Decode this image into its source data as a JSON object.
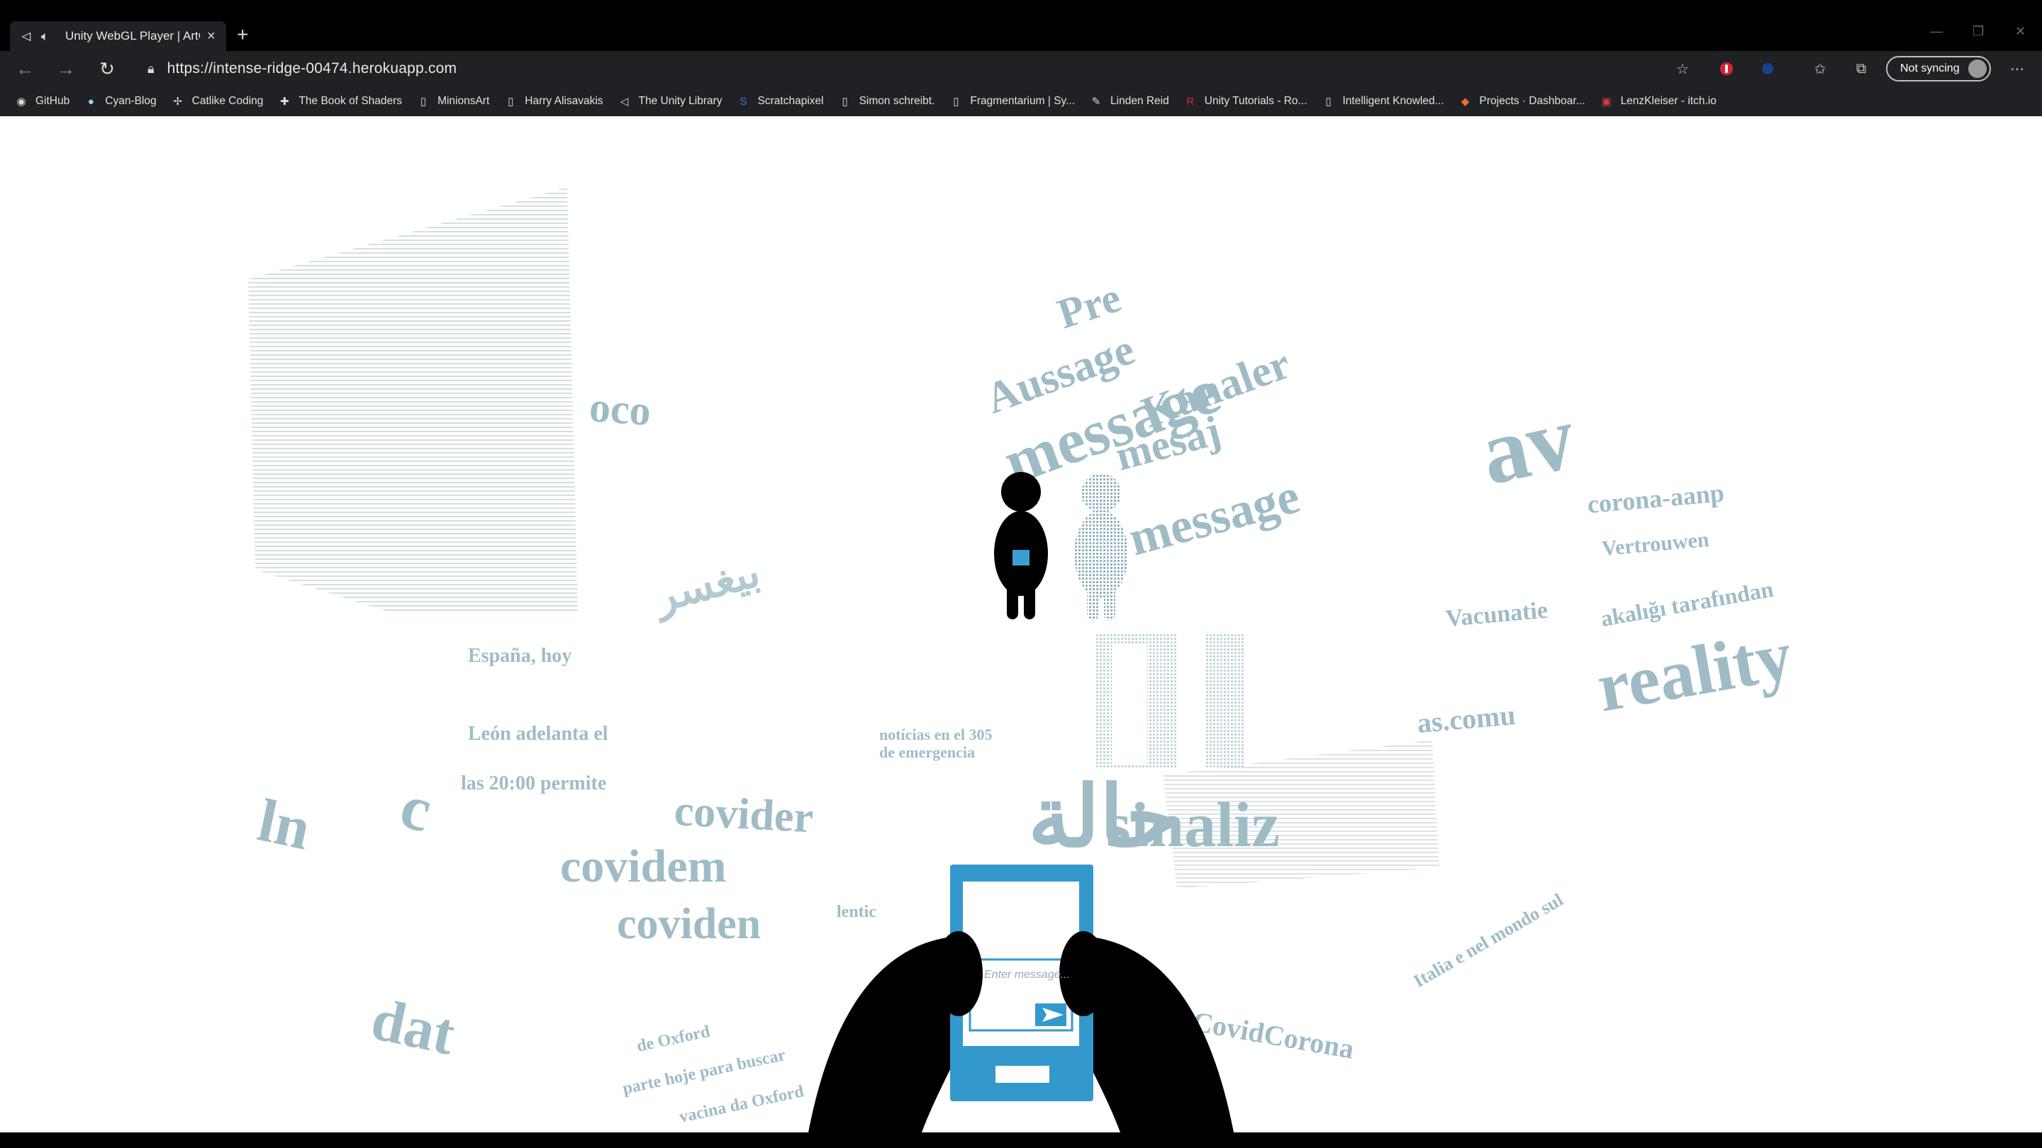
{
  "browser": {
    "tab_title": "Unity WebGL Player | ArtGa",
    "url": "https://intense-ridge-00474.herokuapp.com",
    "sync_label": "Not syncing",
    "bookmarks": [
      {
        "label": "GitHub",
        "icon": "github-icon"
      },
      {
        "label": "Cyan-Blog",
        "icon": "blog-icon"
      },
      {
        "label": "Catlike Coding",
        "icon": "catlike-icon"
      },
      {
        "label": "The Book of Shaders",
        "icon": "shader-icon"
      },
      {
        "label": "MinionsArt",
        "icon": "page-icon"
      },
      {
        "label": "Harry Alisavakis",
        "icon": "page-icon"
      },
      {
        "label": "The Unity Library",
        "icon": "unity-icon"
      },
      {
        "label": "Scratchapixel",
        "icon": "scratchapixel-icon"
      },
      {
        "label": "Simon schreibt.",
        "icon": "page-icon"
      },
      {
        "label": "Fragmentarium | Sy...",
        "icon": "page-icon"
      },
      {
        "label": "Linden Reid",
        "icon": "linden-icon"
      },
      {
        "label": "Unity Tutorials - Ro...",
        "icon": "r-icon"
      },
      {
        "label": "Intelligent Knowled...",
        "icon": "page-icon"
      },
      {
        "label": "Projects · Dashboar...",
        "icon": "gitlab-icon"
      },
      {
        "label": "LenzKleiser - itch.io",
        "icon": "itch-icon"
      }
    ]
  },
  "scene": {
    "phone_placeholder": "Enter message...",
    "text_fragments": [
      "Pre",
      "message",
      "Aussage",
      "Kanaler",
      "mesaj",
      "av",
      "reality",
      "c",
      "covider",
      "covidem",
      "coviden",
      "dat",
      "ln",
      "oco",
      "بيغسر",
      "حالة",
      "message",
      "as.comu",
      "Vacunatie",
      "corona-aanp",
      "Vertrouwen",
      "akalığı tarafından",
      "CovidCorona",
      "Italia e nel mondo sul",
      "lentic",
      "sinaliz",
      "León adelanta el",
      "las 20:00 permite",
      "España, hoy",
      "notícias en el 305",
      "de emergencia",
      "de Oxford",
      "parte hoje para buscar",
      "vacina da Oxford"
    ]
  },
  "colors": {
    "text_fragment": "#9fbcc6",
    "phone_blue": "#3399cc",
    "silhouette": "#000000"
  }
}
